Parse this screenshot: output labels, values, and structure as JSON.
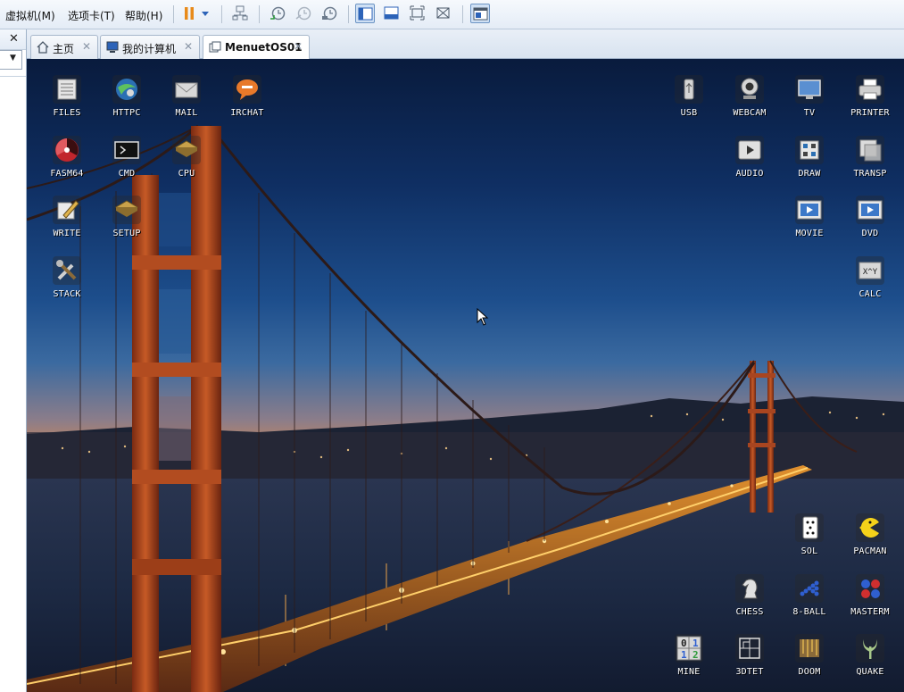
{
  "menubar": {
    "items": [
      "虚拟机(M)",
      "选项卡(T)",
      "帮助(H)"
    ],
    "toolbar_icons": [
      "pause-icon",
      "dropdown-arrow-icon",
      "network-icon",
      "snapshot-icon",
      "snapshot-revert-icon",
      "snapshot-manager-icon",
      "console-view-icon",
      "thumbnail-view-icon",
      "fullscreen-icon",
      "unity-icon",
      "library-view-icon"
    ]
  },
  "leftpanel": {
    "close_glyph": "✕",
    "select_arrow": "▼"
  },
  "tabs": [
    {
      "label": "主页",
      "icon": "home-icon",
      "close": "✕"
    },
    {
      "label": "我的计算机",
      "icon": "computer-icon",
      "close": "✕"
    },
    {
      "label": "MenuetOS01",
      "icon": "vm-icon",
      "close": "✕",
      "active": true
    }
  ],
  "desktop": {
    "icons": [
      {
        "label": "FILES",
        "icon": "files-icon"
      },
      {
        "label": "HTTPC",
        "icon": "httpc-icon"
      },
      {
        "label": "MAIL",
        "icon": "mail-icon"
      },
      {
        "label": "IRCHAT",
        "icon": "irchat-icon"
      },
      {
        "label": "FASM64",
        "icon": "fasm64-icon"
      },
      {
        "label": "CMD",
        "icon": "cmd-icon"
      },
      {
        "label": "CPU",
        "icon": "cpu-icon"
      },
      {
        "label": "WRITE",
        "icon": "write-icon"
      },
      {
        "label": "SETUP",
        "icon": "setup-icon"
      },
      {
        "label": "STACK",
        "icon": "stack-icon"
      },
      {
        "label": "USB",
        "icon": "usb-icon"
      },
      {
        "label": "WEBCAM",
        "icon": "webcam-icon"
      },
      {
        "label": "TV",
        "icon": "tv-icon"
      },
      {
        "label": "PRINTER",
        "icon": "printer-icon"
      },
      {
        "label": "AUDIO",
        "icon": "audio-icon"
      },
      {
        "label": "DRAW",
        "icon": "draw-icon"
      },
      {
        "label": "TRANSP",
        "icon": "transp-icon"
      },
      {
        "label": "MOVIE",
        "icon": "movie-icon"
      },
      {
        "label": "DVD",
        "icon": "dvd-icon"
      },
      {
        "label": "CALC",
        "icon": "calc-icon"
      },
      {
        "label": "SOL",
        "icon": "solitaire-icon"
      },
      {
        "label": "PACMAN",
        "icon": "pacman-icon"
      },
      {
        "label": "CHESS",
        "icon": "chess-icon"
      },
      {
        "label": "8-BALL",
        "icon": "eight-ball-icon"
      },
      {
        "label": "MASTERM",
        "icon": "mastermind-icon"
      },
      {
        "label": "MINE",
        "icon": "minesweeper-icon"
      },
      {
        "label": "3DTET",
        "icon": "tetris-3d-icon"
      },
      {
        "label": "DOOM",
        "icon": "doom-icon"
      },
      {
        "label": "QUAKE",
        "icon": "quake-icon"
      }
    ],
    "calc_icon_text": "X^Y",
    "mine_digits": [
      "0",
      "1",
      "1",
      "2"
    ]
  },
  "colors": {
    "accent": "#6c94c4",
    "sky_top": "#091b3d",
    "bridge": "#b8441c",
    "pause": "#e88a1a"
  }
}
